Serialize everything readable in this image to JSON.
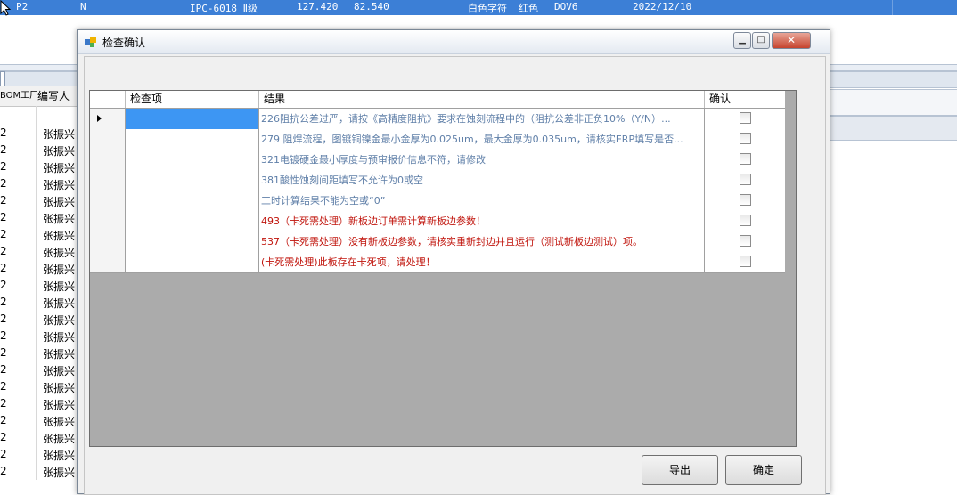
{
  "background": {
    "top_row": {
      "c1": "P2",
      "c2": "N",
      "c3": "IPC-6018 Ⅱ级",
      "c4": "127.420",
      "c5": "82.540",
      "c6": "白色字符",
      "c7": "红色",
      "c8": "DOV6",
      "c9": "2022/12/10"
    },
    "grid_headers": [
      "BOM工厂",
      "编写人"
    ],
    "row_code": "2",
    "row_name": "张振兴"
  },
  "dialog": {
    "title": "检查确认",
    "window_buttons": {
      "minimize": "▁",
      "maximize": "□",
      "close": "✕"
    },
    "grid": {
      "columns": [
        "检查项",
        "结果",
        "确认"
      ],
      "rows": [
        {
          "item": "",
          "result": "226阻抗公差过严，请按《高精度阻抗》要求在蚀刻流程中的（阻抗公差非正负10%（Y/N）...",
          "color": "#5f7fa8",
          "checked": false
        },
        {
          "item": "",
          "result": "279 阻焊流程，图镀铜镍金最小金厚为0.025um，最大金厚为0.035um，请核实ERP填写是否...",
          "color": "#5f7fa8",
          "checked": false
        },
        {
          "item": "",
          "result": "321电镀硬金最小厚度与预审报价信息不符，请修改",
          "color": "#5f7fa8",
          "checked": false
        },
        {
          "item": "",
          "result": "381酸性蚀刻间距填写不允许为0或空",
          "color": "#5f7fa8",
          "checked": false
        },
        {
          "item": "",
          "result": "工时计算结果不能为空或“0”",
          "color": "#5f7fa8",
          "checked": false
        },
        {
          "item": "",
          "result": "493（卡死需处理）新板边订单需计算新板边参数！",
          "color": "#c0140c",
          "checked": false
        },
        {
          "item": "",
          "result": "537（卡死需处理）没有新板边参数，请核实重新封边并且运行（测试新板边测试）项。",
          "color": "#c0140c",
          "checked": false
        },
        {
          "item": "",
          "result": "(卡死需处理)此板存在卡死项，请处理！",
          "color": "#c0140c",
          "checked": false
        }
      ]
    },
    "buttons": {
      "export": "导出",
      "ok": "确定"
    }
  }
}
